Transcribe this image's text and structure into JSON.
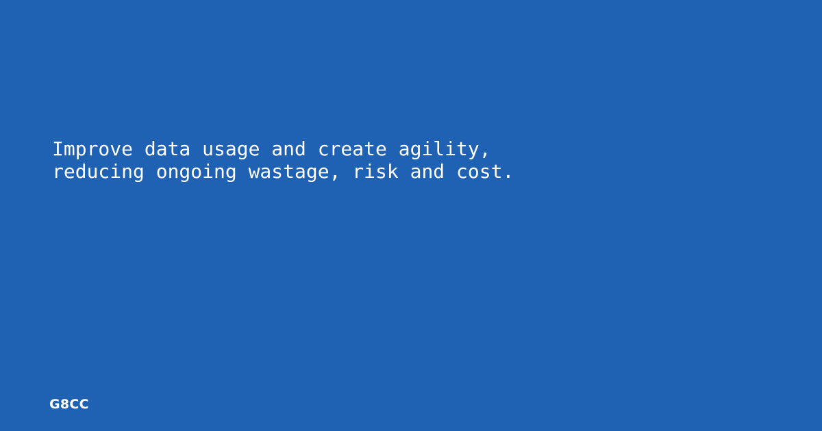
{
  "theme": {
    "background": "#1f61b2",
    "text": "#ffffff"
  },
  "headline": {
    "lines": [
      "Improve data usage and create agility,",
      "reducing ongoing wastage, risk and cost."
    ]
  },
  "brand": {
    "label": "G8CC"
  }
}
